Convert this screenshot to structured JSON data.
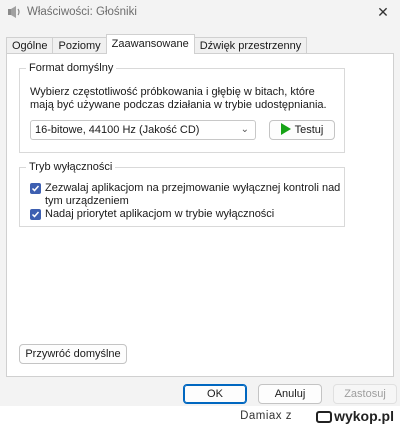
{
  "window": {
    "title": "Właściwości: Głośniki",
    "close_glyph": "✕"
  },
  "tabs": [
    {
      "label": "Ogólne",
      "active": false
    },
    {
      "label": "Poziomy",
      "active": false
    },
    {
      "label": "Zaawansowane",
      "active": true
    },
    {
      "label": "Dźwięk przestrzenny",
      "active": false
    }
  ],
  "default_format": {
    "legend": "Format domyślny",
    "description": "Wybierz częstotliwość próbkowania i głębię w bitach, które mają być używane podczas działania w trybie udostępniania.",
    "selected_format": "16-bitowe, 44100 Hz (Jakość CD)",
    "test_label": "Testuj",
    "test_icon": "play-icon",
    "test_icon_color": "#16a316"
  },
  "exclusive_mode": {
    "legend": "Tryb wyłączności",
    "options": [
      {
        "label": "Zezwalaj aplikacjom na przejmowanie wyłącznej kontroli nad tym urządzeniem",
        "checked": true
      },
      {
        "label": "Nadaj priorytet aplikacjom w trybie wyłączności",
        "checked": true
      }
    ],
    "checkbox_color": "#3d5fb1"
  },
  "restore_defaults_label": "Przywróć domyślne",
  "footer": {
    "ok_label": "OK",
    "cancel_label": "Anuluj",
    "apply_label": "Zastosuj",
    "accent": "#0067c0"
  },
  "watermark": {
    "user": "Damiax z",
    "site": "wykop.pl"
  }
}
